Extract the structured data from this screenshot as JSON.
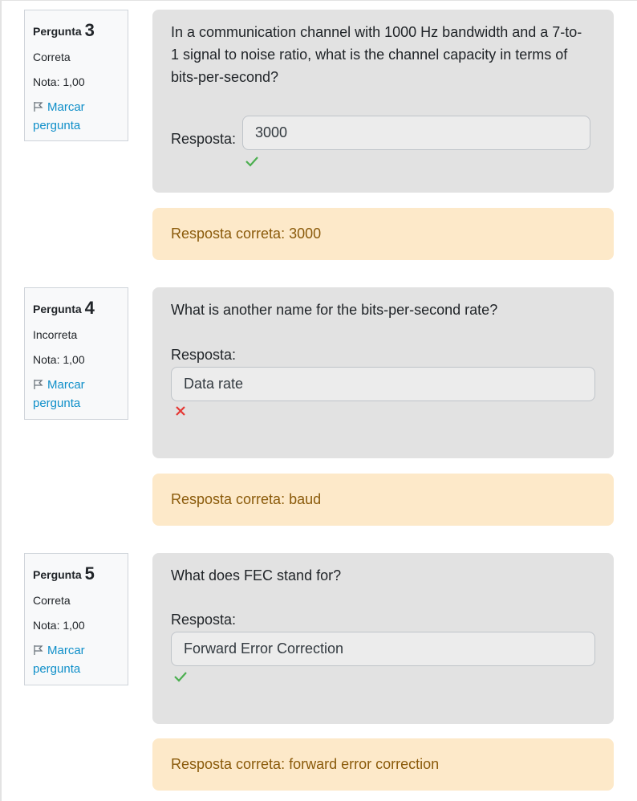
{
  "questions": [
    {
      "label": "Pergunta",
      "number": "3",
      "state": "Correta",
      "grade": "Nota: 1,00",
      "flag_label": "Marcar pergunta",
      "text": "In a communication channel with 1000 Hz bandwidth and a 7-to-1 signal to noise ratio, what is the channel capacity in terms of bits-per-second?",
      "answer_label": "Resposta:",
      "answer_value": "3000",
      "result_icon": "check-icon",
      "feedback": "Resposta correta: 3000"
    },
    {
      "label": "Pergunta",
      "number": "4",
      "state": "Incorreta",
      "grade": "Nota: 1,00",
      "flag_label": "Marcar pergunta",
      "text": "What is another name for the bits-per-second rate?",
      "answer_label": "Resposta:",
      "answer_value": "Data rate",
      "result_icon": "cross-icon",
      "feedback": "Resposta correta: baud"
    },
    {
      "label": "Pergunta",
      "number": "5",
      "state": "Correta",
      "grade": "Nota: 1,00",
      "flag_label": "Marcar pergunta",
      "text": "What does FEC stand for?",
      "answer_label": "Resposta:",
      "answer_value": "Forward Error Correction",
      "result_icon": "check-icon",
      "feedback": "Resposta correta: forward error correction"
    }
  ],
  "colors": {
    "correct": "#4caf50",
    "incorrect": "#e53935",
    "link": "#0f8fc9",
    "feedback_bg": "#fde9c9",
    "feedback_text": "#8a5a0a"
  }
}
